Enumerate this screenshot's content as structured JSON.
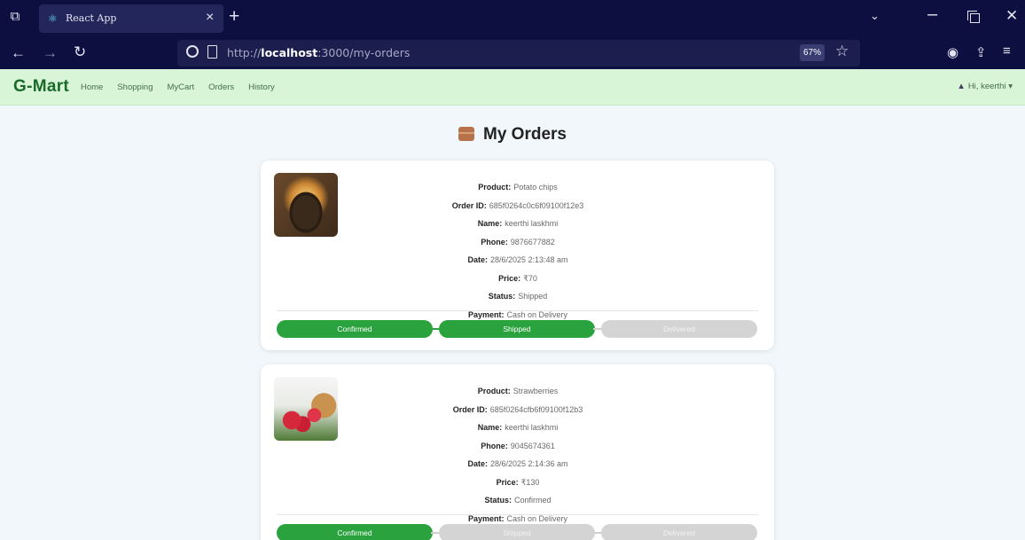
{
  "browser": {
    "tab_title": "React App",
    "url_prefix": "http://",
    "url_host": "localhost",
    "url_path": ":3000/my-orders",
    "zoom": "67%"
  },
  "app": {
    "brand": "G-Mart",
    "nav": [
      "Home",
      "Shopping",
      "MyCart",
      "Orders",
      "History"
    ],
    "user_greeting": "Hi, keerthi"
  },
  "page": {
    "title": "My Orders"
  },
  "labels": {
    "product": "Product:",
    "order_id": "Order ID:",
    "name": "Name:",
    "phone": "Phone:",
    "date": "Date:",
    "price": "Price:",
    "status": "Status:",
    "payment": "Payment:"
  },
  "steps": [
    "Confirmed",
    "Shipped",
    "Delivered"
  ],
  "orders": [
    {
      "product": "Potato chips",
      "order_id": "685f0264c0c6f09100f12e3",
      "name": "keerthi laskhmi",
      "phone": "9876677882",
      "date": "28/6/2025 2:13:48 am",
      "price": "₹70",
      "status": "Shipped",
      "payment": "Cash on Delivery",
      "progress": [
        true,
        true,
        false
      ]
    },
    {
      "product": "Strawberries",
      "order_id": "685f0264cfb6f09100f12b3",
      "name": "keerthi laskhmi",
      "phone": "9045674361",
      "date": "28/6/2025 2:14:36 am",
      "price": "₹130",
      "status": "Confirmed",
      "payment": "Cash on Delivery",
      "progress": [
        true,
        false,
        false
      ]
    }
  ]
}
